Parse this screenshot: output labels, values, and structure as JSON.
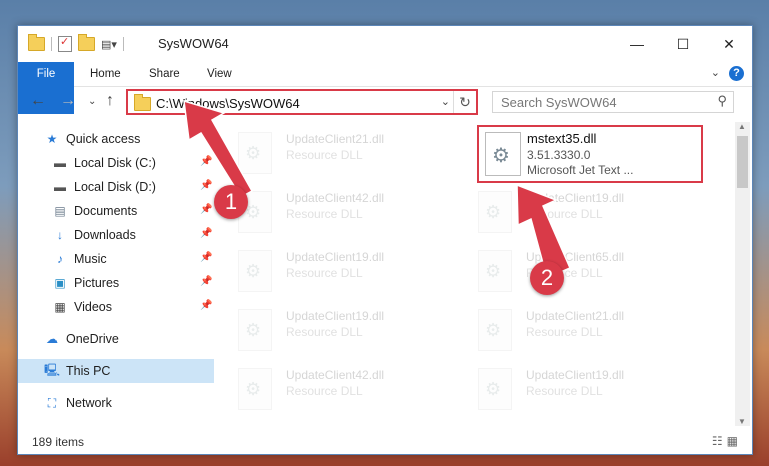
{
  "window": {
    "title": "SysWOW64",
    "controls": {
      "minimize": "—",
      "maximize": "☐",
      "close": "✕"
    }
  },
  "ribbon": {
    "tabs": [
      {
        "label": "File"
      },
      {
        "label": "Home"
      },
      {
        "label": "Share"
      },
      {
        "label": "View"
      }
    ],
    "help": "?"
  },
  "address": {
    "path": "C:\\Windows\\SysWOW64"
  },
  "search": {
    "placeholder": "Search SysWOW64"
  },
  "sidebar": {
    "items": [
      {
        "label": "Quick access",
        "icon": "star-icon"
      },
      {
        "label": "Local Disk (C:)",
        "icon": "drive-icon"
      },
      {
        "label": "Local Disk (D:)",
        "icon": "drive-icon"
      },
      {
        "label": "Documents",
        "icon": "documents-icon"
      },
      {
        "label": "Downloads",
        "icon": "download-icon"
      },
      {
        "label": "Music",
        "icon": "music-icon"
      },
      {
        "label": "Pictures",
        "icon": "pictures-icon"
      },
      {
        "label": "Videos",
        "icon": "videos-icon"
      },
      {
        "label": "OneDrive",
        "icon": "cloud-icon"
      },
      {
        "label": "This PC",
        "icon": "computer-icon"
      },
      {
        "label": "Network",
        "icon": "network-icon"
      }
    ]
  },
  "files": {
    "left": [
      {
        "name": "UpdateClient21.dll",
        "type": "Resource DLL"
      },
      {
        "name": "UpdateClient42.dll",
        "type": "Resource DLL"
      },
      {
        "name": "UpdateClient19.dll",
        "type": "Resource DLL"
      },
      {
        "name": "UpdateClient19.dll",
        "type": "Resource DLL"
      },
      {
        "name": "UpdateClient42.dll",
        "type": "Resource DLL"
      }
    ],
    "right": [
      {
        "name": "UpdateClient19.dll",
        "type": "Resource DLL"
      },
      {
        "name": "UpdateClient65.dll",
        "type": "Resource DLL"
      },
      {
        "name": "UpdateClient21.dll",
        "type": "Resource DLL"
      },
      {
        "name": "UpdateClient19.dll",
        "type": "Resource DLL"
      }
    ],
    "highlighted": {
      "name": "mstext35.dll",
      "version": "3.51.3330.0",
      "description": "Microsoft Jet Text ..."
    }
  },
  "status": {
    "count": "189 items"
  },
  "annotations": {
    "step1": "1",
    "step2": "2",
    "color": "#d93a48"
  }
}
